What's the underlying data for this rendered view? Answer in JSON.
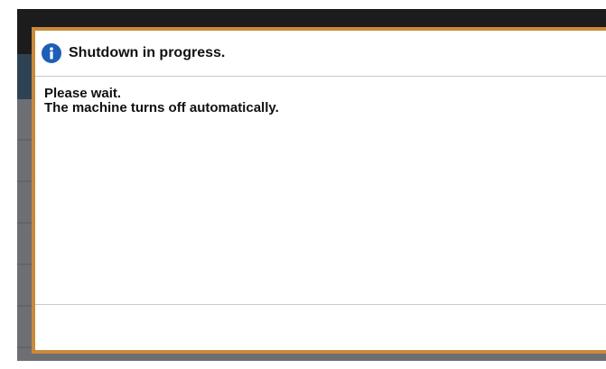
{
  "dialog": {
    "icon": "info-icon",
    "title": "Shutdown in progress.",
    "message_line1": "Please wait.",
    "message_line2": "The machine turns off automatically."
  },
  "colors": {
    "dialog_border": "#c98a3a",
    "info_icon": "#1d5fb8",
    "header_bar": "#2d4353",
    "background_dim": "#6d6f74"
  }
}
